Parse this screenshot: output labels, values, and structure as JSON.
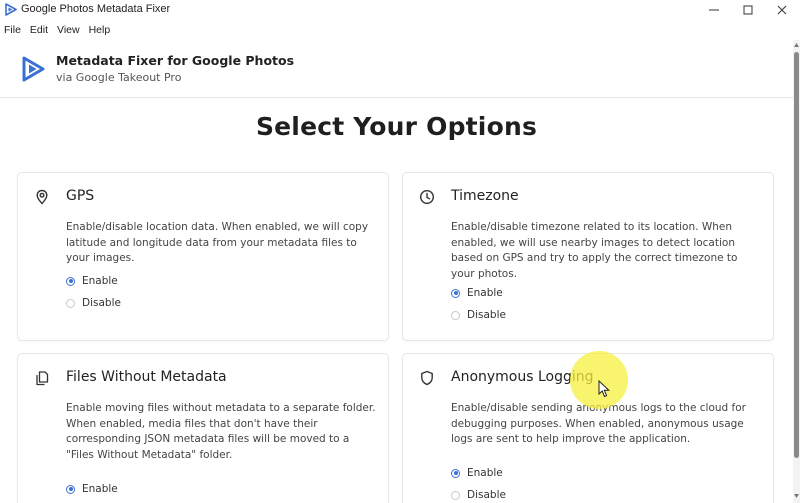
{
  "window": {
    "title": "Google Photos Metadata Fixer",
    "app_icon": "play-triangle-icon",
    "controls": {
      "minimize_icon": "minimize-icon",
      "maximize_icon": "maximize-icon",
      "close_icon": "close-icon"
    }
  },
  "menu": {
    "items": [
      "File",
      "Edit",
      "View",
      "Help"
    ]
  },
  "header": {
    "title": "Metadata Fixer for Google Photos",
    "subtitle": "via Google Takeout Pro",
    "logo": "play-triangle-logo-icon"
  },
  "page": {
    "title": "Select Your Options"
  },
  "cards": {
    "gps": {
      "icon": "location-pin-icon",
      "title": "GPS",
      "description": "Enable/disable location data. When enabled, we will copy latitude and longitude data from your metadata files to your images.",
      "options": [
        "Enable",
        "Disable"
      ],
      "selected": "Enable"
    },
    "timezone": {
      "icon": "clock-icon",
      "title": "Timezone",
      "description": "Enable/disable timezone related to its location. When enabled, we will use nearby images to detect location based on GPS and try to apply the correct timezone to your photos.",
      "options": [
        "Enable",
        "Disable"
      ],
      "selected": "Enable"
    },
    "files_without_metadata": {
      "icon": "files-icon",
      "title": "Files Without Metadata",
      "description": "Enable moving files without metadata to a separate folder. When enabled, media files that don't have their corresponding JSON metadata files will be moved to a \"Files Without Metadata\" folder.",
      "options": [
        "Enable"
      ],
      "selected": "Enable"
    },
    "anonymous_logging": {
      "icon": "shield-icon",
      "title": "Anonymous Logging",
      "description": "Enable/disable sending anonymous logs to the cloud for debugging purposes. When enabled, anonymous usage logs are sent to help improve the application.",
      "options": [
        "Enable",
        "Disable"
      ],
      "selected": "Enable"
    }
  },
  "colors": {
    "accent": "#3d6fd6",
    "logo": "#3b6fd4",
    "highlight": "#f5f03c"
  }
}
